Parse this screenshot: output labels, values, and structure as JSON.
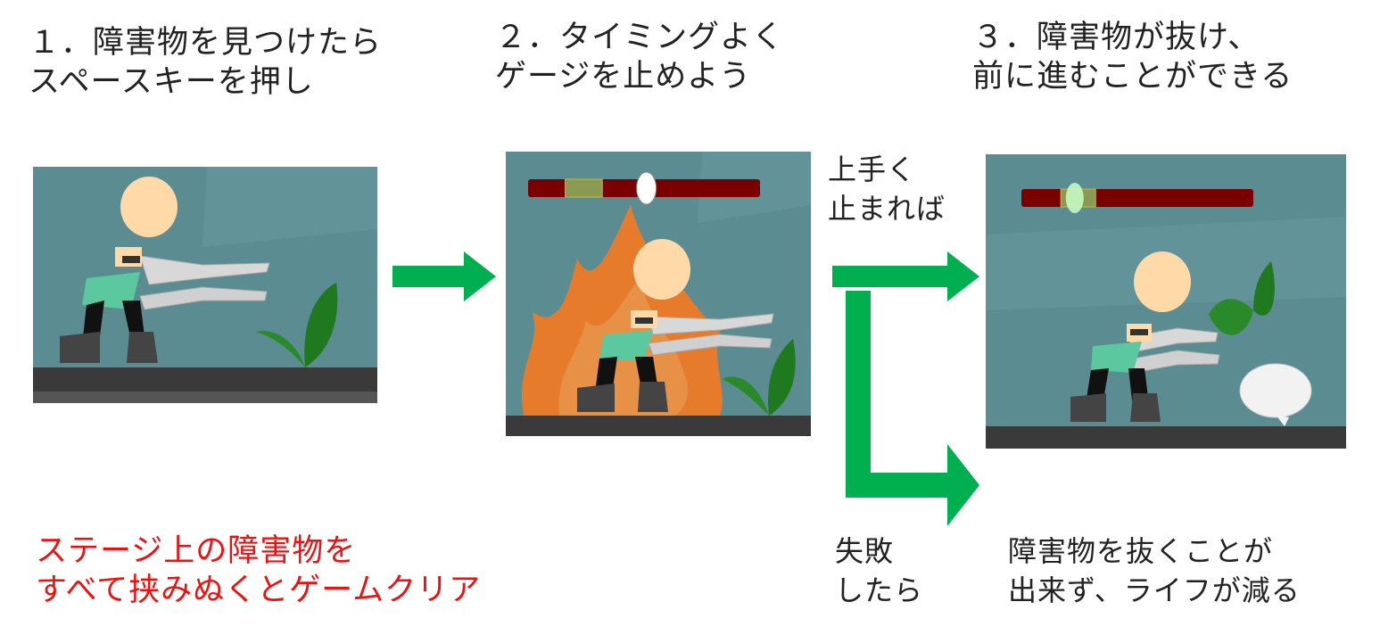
{
  "steps": [
    {
      "line1": "１．障害物を見つけたら",
      "line2": "スペースキーを押し"
    },
    {
      "line1": "２．タイミングよく",
      "line2": "ゲージを止めよう"
    },
    {
      "line1": "３．障害物が抜け、",
      "line2": "前に進むことができる"
    }
  ],
  "branches": {
    "success": {
      "line1": "上手く",
      "line2": "止まれば"
    },
    "fail": {
      "line1": "失敗",
      "line2": "したら"
    },
    "fail_result": {
      "line1": "障害物を抜くことが",
      "line2": "出来ず、ライフが減る"
    }
  },
  "goal": {
    "line1": "ステージ上の障害物を",
    "line2": "すべて挟みぬくとゲームクリア"
  },
  "colors": {
    "scene_bg": "#5a8c92",
    "floor": "#3a3a3a",
    "arrow": "#00b050",
    "gauge": "#7a0000",
    "gauge_zone": "#8a9a50",
    "leaf": "#1f7a1f",
    "goal_text": "#ee1111"
  },
  "gauge_state": {
    "scene2": {
      "zone_start": 0.16,
      "zone_end": 0.32,
      "marker": 0.51
    },
    "scene3": {
      "zone_start": 0.17,
      "zone_end": 0.32,
      "marker": 0.23
    }
  }
}
